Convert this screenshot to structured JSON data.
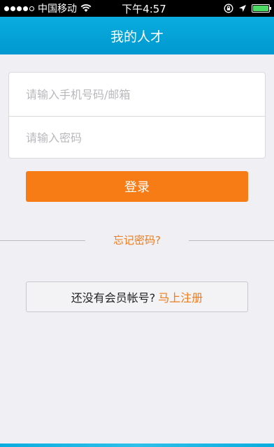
{
  "status_bar": {
    "carrier": "中国移动",
    "time": "下午4:57",
    "signal_bars": 5,
    "signal_filled": 4,
    "battery_level": 1.0,
    "wifi_icon": "wifi-icon",
    "lock_icon": "orientation-lock-icon",
    "location_icon": "location-arrow-icon"
  },
  "navbar": {
    "title": "我的人才"
  },
  "login_form": {
    "username_placeholder": "请输入手机号码/邮箱",
    "username_value": "",
    "password_placeholder": "请输入密码",
    "password_value": "",
    "login_label": "登录"
  },
  "forgot_password": "忘记密码?",
  "register": {
    "prompt": "还没有会员帐号?",
    "link": "马上注册"
  },
  "colors": {
    "accent": "#f77c16",
    "nav_blue": "#0aaddf",
    "link_orange": "#f07b1a"
  }
}
